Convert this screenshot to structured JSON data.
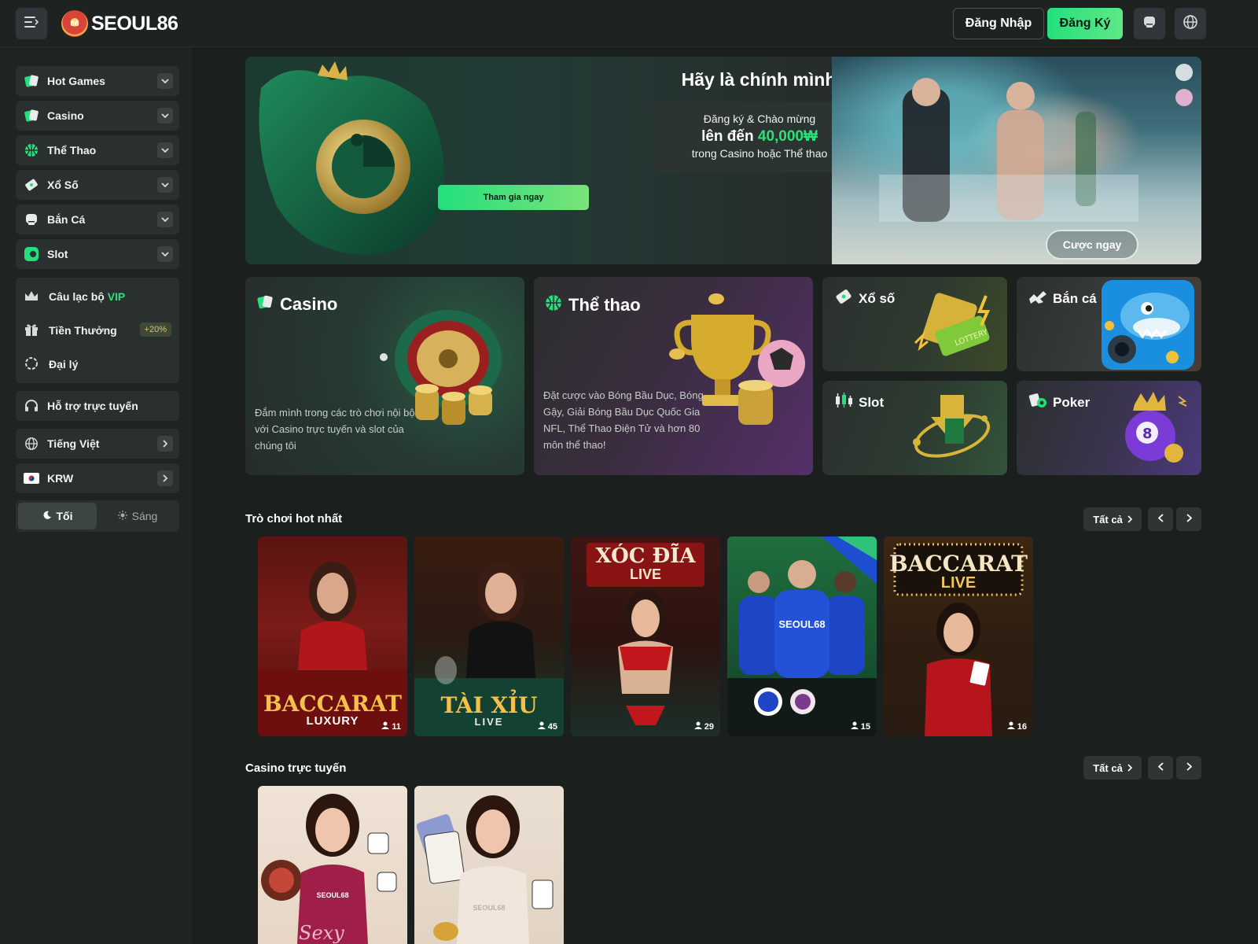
{
  "header": {
    "logo_text": "SEOUL86",
    "logo_chip_text": "86",
    "login_label": "Đăng Nhập",
    "register_label": "Đăng Ký"
  },
  "sidebar": {
    "items": [
      {
        "label": "Hot Games",
        "icon": "cards-icon"
      },
      {
        "label": "Casino",
        "icon": "cards-icon"
      },
      {
        "label": "Thể Thao",
        "icon": "basketball-icon"
      },
      {
        "label": "Xổ Số",
        "icon": "ticket-icon"
      },
      {
        "label": "Bắn Cá",
        "icon": "fish-icon"
      },
      {
        "label": "Slot",
        "icon": "slot-icon"
      }
    ],
    "vip_prefix": "Câu lạc bộ",
    "vip_word": "VIP",
    "bonus_label": "Tiền Thưởng",
    "bonus_badge": "+20%",
    "agent_label": "Đại lý",
    "support_label": "Hỗ trợ trực tuyến",
    "language_label": "Tiếng Việt",
    "currency_label": "KRW",
    "theme_dark": "Tối",
    "theme_light": "Sáng"
  },
  "banner": {
    "title": "Hãy là chính mình",
    "line1": "Đăng ký & Chào mừng",
    "line2_prefix": "lên đến",
    "amount": "40,000₩",
    "line3": "trong Casino hoặc Thể thao",
    "join_label": "Tham gia ngay",
    "bet_label": "Cược ngay"
  },
  "categories": {
    "casino": {
      "title": "Casino",
      "desc": "Đắm mình trong các trò chơi nội bộ với Casino trực tuyến và slot của chúng tôi"
    },
    "sports": {
      "title": "Thể thao",
      "desc": "Đặt cược vào Bóng Bầu Dục, Bóng Gậy, Giải Bóng Bầu Dục Quốc Gia NFL, Thể Thao Điện Tử và hơn 80 môn thể thao!"
    },
    "lottery": {
      "title": "Xổ số",
      "art_text": "LOTTERY"
    },
    "fishing": {
      "title": "Bắn cá"
    },
    "slot": {
      "title": "Slot"
    },
    "poker": {
      "title": "Poker"
    }
  },
  "hot_section": {
    "title": "Trò chơi hot nhất",
    "all_label": "Tất cả",
    "games": [
      {
        "line1": "BACCARAT",
        "line2": "LUXURY",
        "players": "11"
      },
      {
        "line1": "TÀI XỈU",
        "line2": "LIVE",
        "players": "45"
      },
      {
        "line1": "XÓC ĐĨA",
        "line2": "LIVE",
        "players": "29"
      },
      {
        "line1": "SEOUL68",
        "line2": "",
        "players": "15"
      },
      {
        "line1": "BACCARAT",
        "line2": "LIVE",
        "players": "16"
      }
    ]
  },
  "casino_section": {
    "title": "Casino trực tuyến",
    "all_label": "Tất cả",
    "games": [
      {
        "label": "SEOUL68",
        "script": "Sexy"
      },
      {
        "label": "SEOUL68"
      }
    ]
  },
  "colors": {
    "accent": "#23e07c",
    "background": "#1b1f1e",
    "sidebar": "#1f2423",
    "panel": "#2a302f"
  }
}
